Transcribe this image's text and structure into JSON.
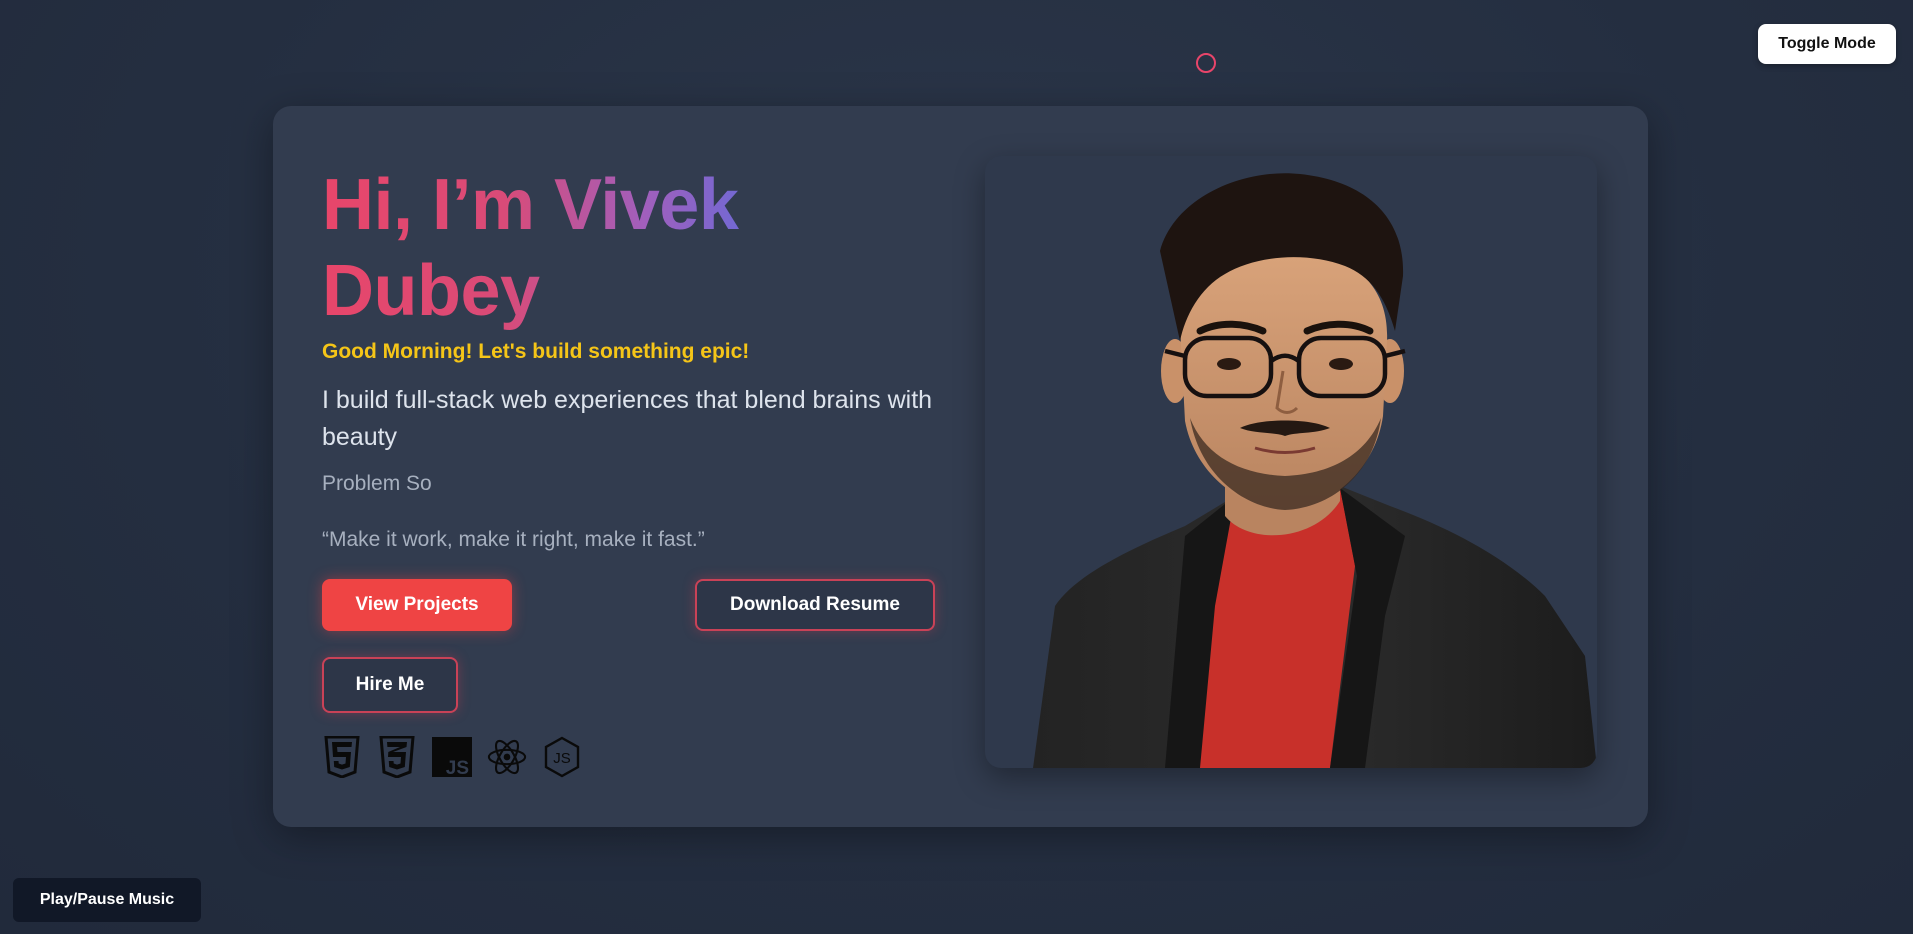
{
  "header": {
    "toggle_mode_label": "Toggle Mode"
  },
  "hero": {
    "title": "Hi, I’m Vivek Dubey",
    "greeting": "Good Morning! Let's build something epic!",
    "tagline": "I build full-stack web experiences that blend brains with beauty",
    "role_typing": "Problem So",
    "quote": "“Make it work, make it right, make it fast.”",
    "buttons": {
      "view_projects": "View Projects",
      "download_resume": "Download Resume",
      "hire_me": "Hire Me"
    },
    "tech_icons": [
      "html5-icon",
      "css3-icon",
      "javascript-icon",
      "react-icon",
      "nodejs-icon"
    ]
  },
  "footer": {
    "music_label": "Play/Pause Music"
  },
  "colors": {
    "background": "#252f41",
    "card": "#323c4f",
    "accent_red": "#ef4444",
    "greeting_yellow": "#f5c518",
    "title_pink": "#e8466a",
    "title_purple": "#7468d2"
  }
}
